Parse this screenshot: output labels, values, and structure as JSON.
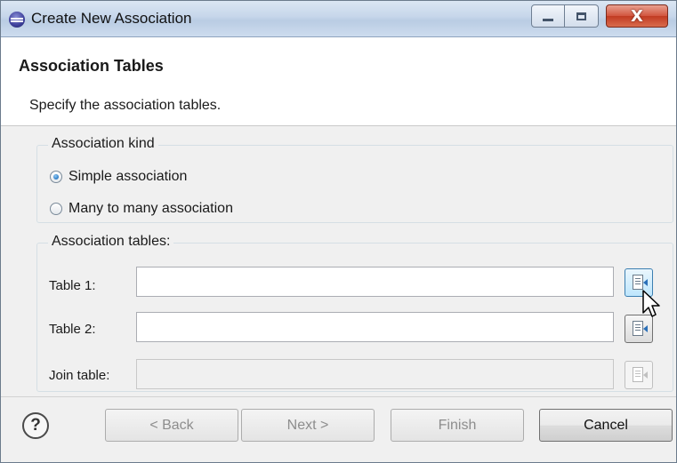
{
  "window": {
    "title": "Create New Association",
    "close_glyph": "X",
    "min_icon": "minimize-icon",
    "max_icon": "maximize-icon"
  },
  "header": {
    "title": "Association Tables",
    "description": "Specify the association tables."
  },
  "association_kind": {
    "legend": "Association kind",
    "options": [
      {
        "label": "Simple association",
        "selected": true
      },
      {
        "label": "Many to many association",
        "selected": false
      }
    ]
  },
  "association_tables": {
    "legend": "Association tables:",
    "fields": [
      {
        "label": "Table 1:",
        "value": "",
        "enabled": true
      },
      {
        "label": "Table 2:",
        "value": "",
        "enabled": true
      },
      {
        "label": "Join table:",
        "value": "",
        "enabled": false
      }
    ],
    "browse_icon": "table-browse-icon"
  },
  "footer": {
    "help": "?",
    "back": "< Back",
    "next": "Next >",
    "finish": "Finish",
    "cancel": "Cancel"
  }
}
